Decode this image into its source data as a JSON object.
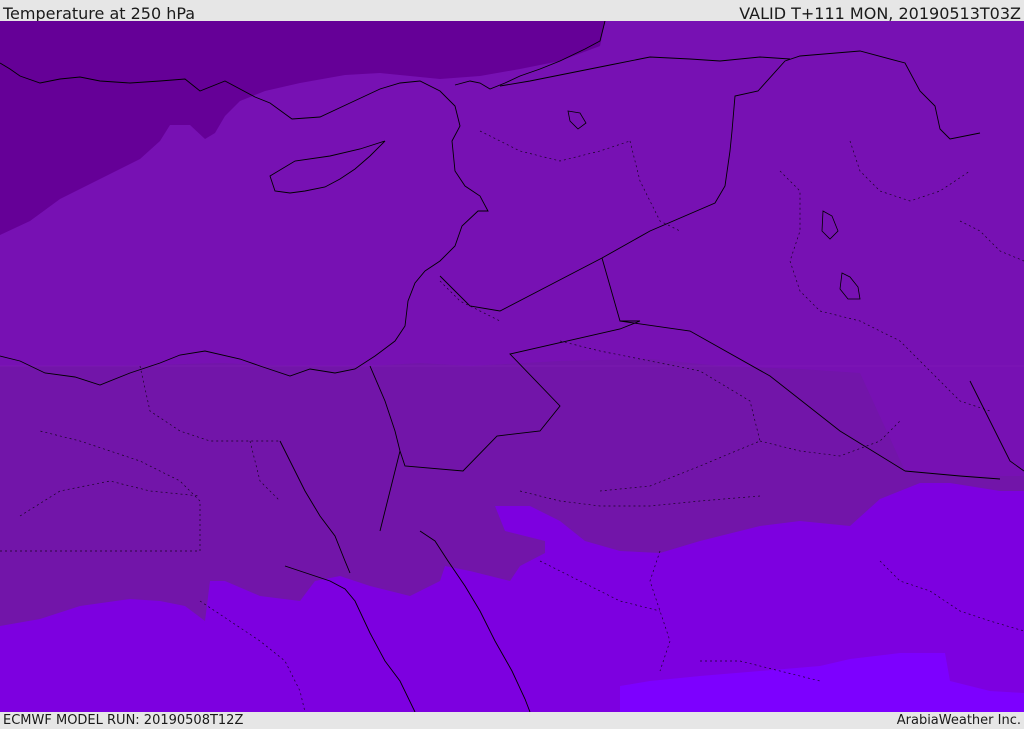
{
  "header": {
    "title": "Temperature at 250 hPa",
    "valid_time": "VALID T+111 MON, 20190513T03Z"
  },
  "footer": {
    "model_run": "ECMWF MODEL RUN: 20190508T12Z",
    "brand": "ArabiaWeather Inc."
  },
  "colors": {
    "frame": "#e6e6e6",
    "text": "#1a1a1a",
    "band_coldest": "#650097",
    "band_cold": "#7711b3",
    "band_mid": "#7215a9",
    "band_warm": "#7d00e0",
    "band_warmest": "#7d00ff",
    "coastline": "#000000"
  }
}
